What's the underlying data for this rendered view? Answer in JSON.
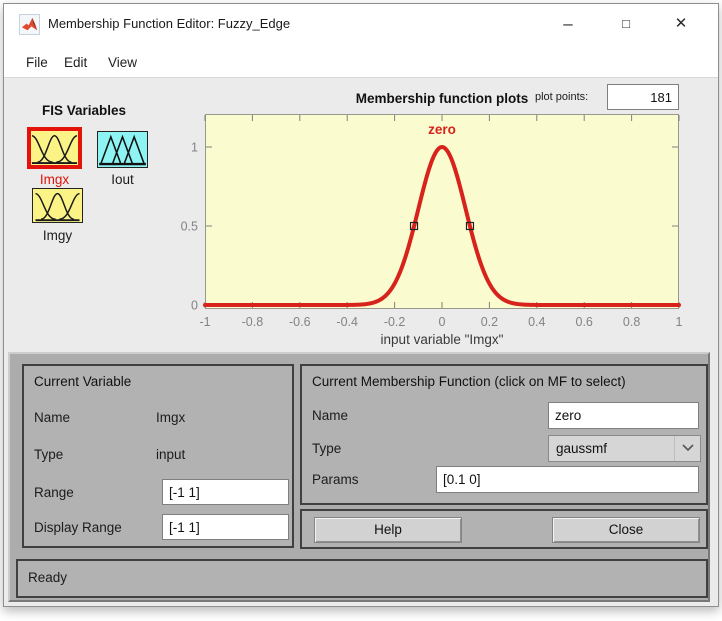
{
  "window": {
    "title": "Membership Function Editor: Fuzzy_Edge",
    "controls": {
      "minimize": "–",
      "maximize": "□",
      "close": "✕"
    }
  },
  "menu": {
    "items": [
      "File",
      "Edit",
      "View"
    ]
  },
  "fis": {
    "heading": "FIS Variables",
    "variables": [
      {
        "label": "Imgx",
        "kind": "input",
        "selected": true
      },
      {
        "label": "Iout",
        "kind": "output",
        "selected": false
      },
      {
        "label": "Imgy",
        "kind": "input",
        "selected": false
      }
    ]
  },
  "plot_header": {
    "title": "Membership function plots",
    "points_label": "plot points:",
    "points_value": "181"
  },
  "chart_data": {
    "type": "line",
    "title": "Membership function plots",
    "xlabel": "input variable \"Imgx\"",
    "xlim": [
      -1,
      1
    ],
    "ylim": [
      -0.03,
      1.19
    ],
    "xticks": [
      -1,
      -0.8,
      -0.6,
      -0.4,
      -0.2,
      0,
      0.2,
      0.4,
      0.6,
      0.8,
      1
    ],
    "xtick_labels": [
      "-1",
      "-0.8",
      "-0.6",
      "-0.4",
      "-0.2",
      "0",
      "0.2",
      "0.4",
      "0.6",
      "0.8",
      "1"
    ],
    "yticks": [
      0,
      0.5,
      1
    ],
    "ytick_labels": [
      "0",
      "0.5",
      "1"
    ],
    "grid": false,
    "plot_bg": "#fbfbd0",
    "series": [
      {
        "name": "zero",
        "mf_type": "gaussmf",
        "params": [
          0.1,
          0
        ],
        "color": "#d8231c"
      }
    ],
    "markers": [
      {
        "x": -0.118,
        "y": 0.5
      },
      {
        "x": 0.118,
        "y": 0.5
      }
    ]
  },
  "current_variable": {
    "heading": "Current Variable",
    "name_label": "Name",
    "name_value": "Imgx",
    "type_label": "Type",
    "type_value": "input",
    "range_label": "Range",
    "range_value": "[-1 1]",
    "display_range_label": "Display Range",
    "display_range_value": "[-1 1]"
  },
  "current_mf": {
    "heading": "Current Membership Function (click on MF to select)",
    "name_label": "Name",
    "name_value": "zero",
    "type_label": "Type",
    "type_value": "gaussmf",
    "params_label": "Params",
    "params_value": "[0.1 0]"
  },
  "actions": {
    "help": "Help",
    "close": "Close"
  },
  "status": {
    "text": "Ready"
  },
  "colors": {
    "selection_red": "#e3120b",
    "curve_red": "#d8231c",
    "input_var_yellow": "#fbf386",
    "output_var_cyan": "#8df3f3",
    "plot_bg": "#fbfbd0"
  }
}
